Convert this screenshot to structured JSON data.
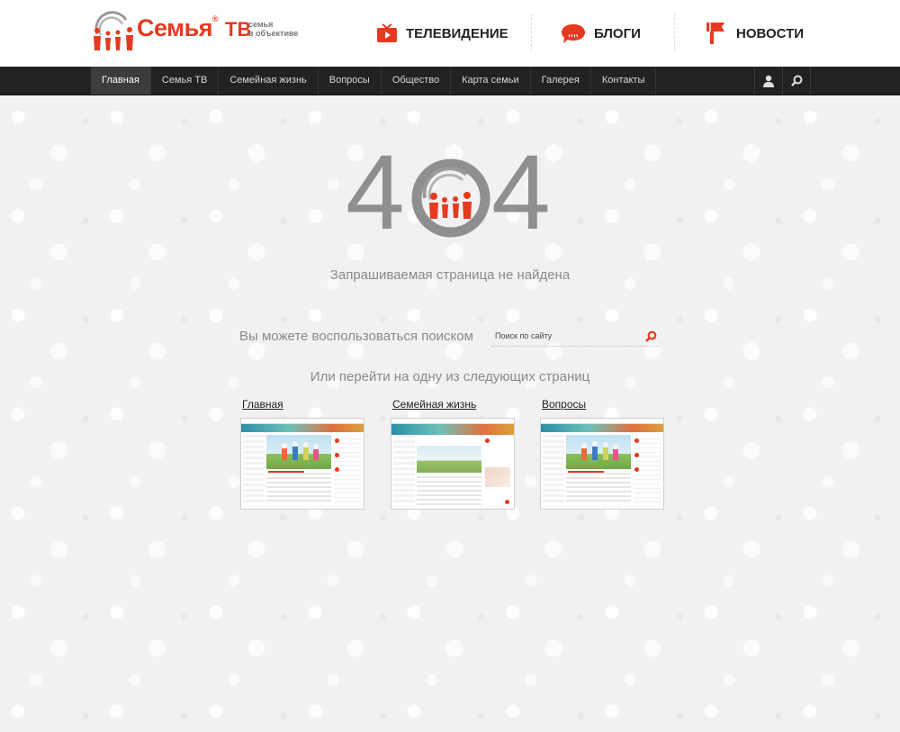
{
  "header": {
    "logo": {
      "word": "Семья",
      "reg": "®",
      "tv": "ТВ",
      "sub_line1": "семья",
      "sub_line2": "в объективе"
    },
    "top_nav": [
      {
        "label": "ТЕЛЕВИДЕНИЕ",
        "icon": "tv-play-icon"
      },
      {
        "label": "БЛОГИ",
        "icon": "speech-bubble-icon"
      },
      {
        "label": "НОВОСТИ",
        "icon": "news-flag-icon"
      }
    ]
  },
  "navbar": {
    "items": [
      "Главная",
      "Семья ТВ",
      "Семейная жизнь",
      "Вопросы",
      "Общество",
      "Карта семьи",
      "Галерея",
      "Контакты"
    ],
    "active_index": 0,
    "icons": [
      "user-icon",
      "search-icon"
    ]
  },
  "error": {
    "code_left": "4",
    "code_right": "4",
    "message": "Запрашиваемая страница не найдена"
  },
  "search": {
    "label": "Вы можете воспользоваться поиском",
    "placeholder": "Поиск по сайту",
    "value": ""
  },
  "suggestions": {
    "heading": "Или перейти на одну из следующих страниц",
    "links": [
      {
        "label": "Главная"
      },
      {
        "label": "Семейная жизнь"
      },
      {
        "label": "Вопросы"
      }
    ]
  },
  "colors": {
    "accent": "#e53a1f",
    "navbar": "#222222",
    "text_gray": "#8a8a8a"
  }
}
